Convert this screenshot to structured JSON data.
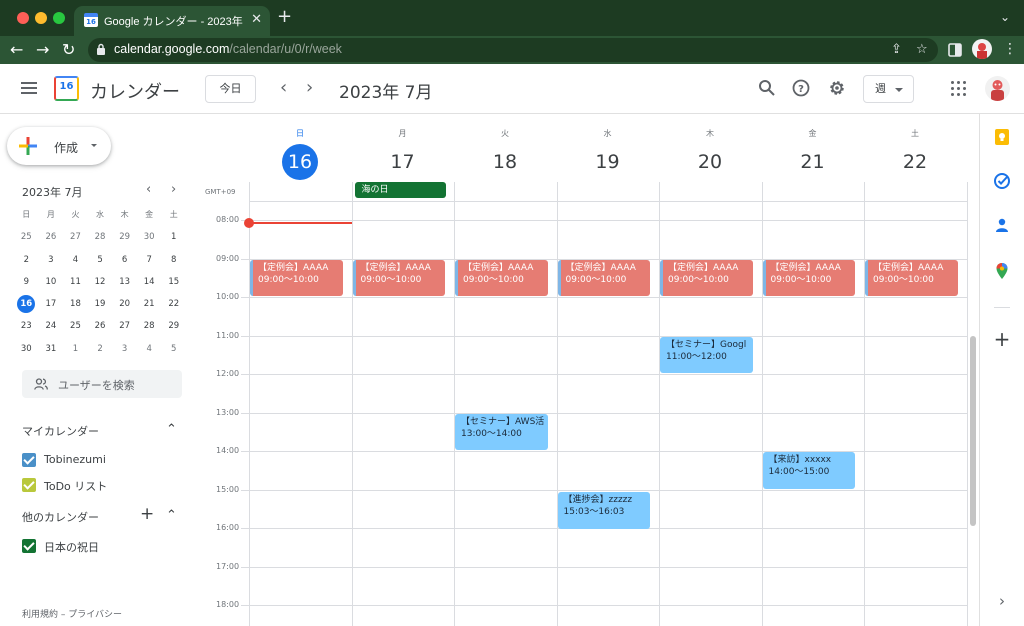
{
  "browser": {
    "tab_title": "Google カレンダー - 2023年 7月",
    "tab_favicon_text": "16",
    "url_host": "calendar.google.com",
    "url_path": "/calendar/u/0/r/week"
  },
  "header": {
    "app_name": "カレンダー",
    "logo_day": "16",
    "today_label": "今日",
    "current_range": "2023年 7月",
    "view_label": "週"
  },
  "sidebar": {
    "create_label": "作成",
    "mini_calendar": {
      "title": "2023年 7月",
      "dow": [
        "日",
        "月",
        "火",
        "水",
        "木",
        "金",
        "土"
      ],
      "weeks": [
        [
          "25",
          "26",
          "27",
          "28",
          "29",
          "30",
          "1"
        ],
        [
          "2",
          "3",
          "4",
          "5",
          "6",
          "7",
          "8"
        ],
        [
          "9",
          "10",
          "11",
          "12",
          "13",
          "14",
          "15"
        ],
        [
          "16",
          "17",
          "18",
          "19",
          "20",
          "21",
          "22"
        ],
        [
          "23",
          "24",
          "25",
          "26",
          "27",
          "28",
          "29"
        ],
        [
          "30",
          "31",
          "1",
          "2",
          "3",
          "4",
          "5"
        ]
      ]
    },
    "search_people": "ユーザーを検索",
    "my_calendars_title": "マイカレンダー",
    "my_calendars": [
      {
        "label": "Tobinezumi",
        "color": "#4a90c8"
      },
      {
        "label": "ToDo リスト",
        "color": "#b9c83c"
      }
    ],
    "other_calendars_title": "他のカレンダー",
    "other_calendars": [
      {
        "label": "日本の祝日",
        "color": "#137333"
      }
    ],
    "footer": "利用規約 – プライバシー"
  },
  "week": {
    "timezone": "GMT+09",
    "days": [
      {
        "dow": "日",
        "num": "16"
      },
      {
        "dow": "月",
        "num": "17"
      },
      {
        "dow": "火",
        "num": "18"
      },
      {
        "dow": "水",
        "num": "19"
      },
      {
        "dow": "木",
        "num": "20"
      },
      {
        "dow": "金",
        "num": "21"
      },
      {
        "dow": "土",
        "num": "22"
      }
    ],
    "hours": [
      "08:00",
      "09:00",
      "10:00",
      "11:00",
      "12:00",
      "13:00",
      "14:00",
      "15:00",
      "16:00",
      "17:00",
      "18:00"
    ],
    "allday_event": {
      "title": "海の日",
      "day": 1
    },
    "events": [
      {
        "day": 0,
        "title": "【定例会】AAAA",
        "time": "09:00〜10:00",
        "color": "red"
      },
      {
        "day": 1,
        "title": "【定例会】AAAA",
        "time": "09:00〜10:00",
        "color": "red"
      },
      {
        "day": 2,
        "title": "【定例会】AAAA",
        "time": "09:00〜10:00",
        "color": "red"
      },
      {
        "day": 3,
        "title": "【定例会】AAAA",
        "time": "09:00〜10:00",
        "color": "red"
      },
      {
        "day": 4,
        "title": "【定例会】AAAA",
        "time": "09:00〜10:00",
        "color": "red"
      },
      {
        "day": 5,
        "title": "【定例会】AAAA",
        "time": "09:00〜10:00",
        "color": "red"
      },
      {
        "day": 6,
        "title": "【定例会】AAAA",
        "time": "09:00〜10:00",
        "color": "red"
      },
      {
        "day": 4,
        "title": "【セミナー】Googl",
        "time": "11:00〜12:00",
        "color": "blue"
      },
      {
        "day": 2,
        "title": "【セミナー】AWS活",
        "time": "13:00〜14:00",
        "color": "blue"
      },
      {
        "day": 5,
        "title": "【来訪】xxxxx",
        "time": "14:00〜15:00",
        "color": "blue"
      },
      {
        "day": 3,
        "title": "【進捗会】zzzzz",
        "time": "15:03〜16:03",
        "color": "blue"
      }
    ]
  },
  "colors": {
    "accent": "#1a73e8",
    "event_red": "#e67c73",
    "event_blue": "#7fcbff",
    "holiday_green": "#137333",
    "now_line": "#ea4335"
  },
  "icons": {
    "rail": [
      "keep-icon",
      "tasks-icon",
      "contacts-icon",
      "maps-icon",
      "add-icon",
      "expand-icon"
    ]
  }
}
